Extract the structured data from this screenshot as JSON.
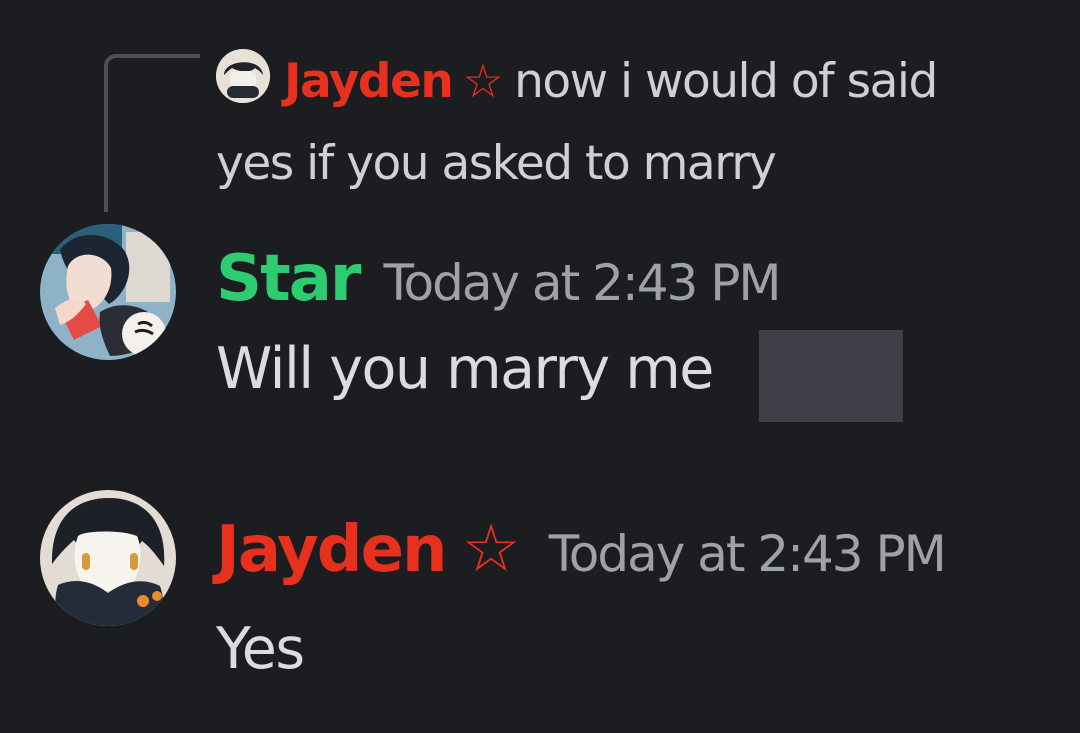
{
  "reply": {
    "author": "Jayden",
    "author_color": "#e8301e",
    "badge_icon": "star-outline-icon",
    "badge_glyph": "☆",
    "text": "now i would of said yes if you asked to marry"
  },
  "messages": [
    {
      "author": "Star",
      "author_color": "#2ecc71",
      "timestamp": "Today at 2:43 PM",
      "text": "Will you marry me"
    },
    {
      "author": "Jayden",
      "author_color": "#e8301e",
      "badge_icon": "star-outline-icon",
      "badge_glyph": "☆",
      "timestamp": "Today at 2:43 PM",
      "text": "Yes"
    }
  ],
  "colors": {
    "background": "#1c1d21",
    "timestamp": "#9fa1a9",
    "reply_line": "#4d4f57",
    "redacted_block": "#3f4047"
  }
}
